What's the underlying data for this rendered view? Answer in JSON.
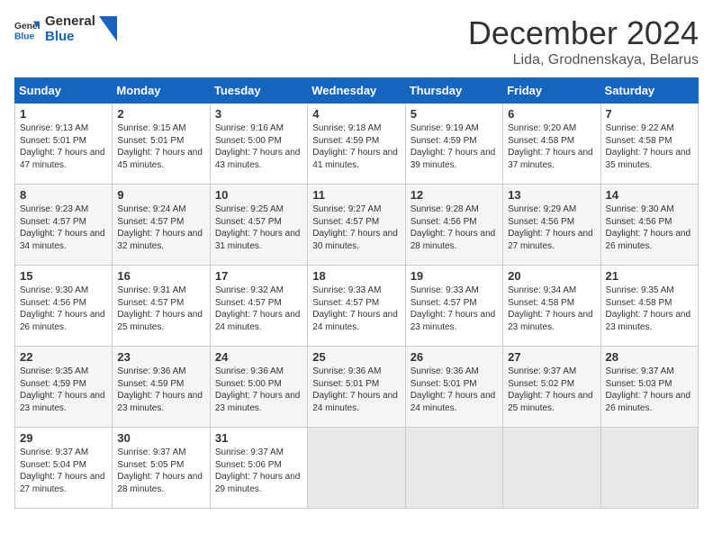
{
  "header": {
    "logo_general": "General",
    "logo_blue": "Blue",
    "month": "December 2024",
    "location": "Lida, Grodnenskaya, Belarus"
  },
  "weekdays": [
    "Sunday",
    "Monday",
    "Tuesday",
    "Wednesday",
    "Thursday",
    "Friday",
    "Saturday"
  ],
  "weeks": [
    [
      {
        "day": "1",
        "sunrise": "Sunrise: 9:13 AM",
        "sunset": "Sunset: 5:01 PM",
        "daylight": "Daylight: 7 hours and 47 minutes."
      },
      {
        "day": "2",
        "sunrise": "Sunrise: 9:15 AM",
        "sunset": "Sunset: 5:01 PM",
        "daylight": "Daylight: 7 hours and 45 minutes."
      },
      {
        "day": "3",
        "sunrise": "Sunrise: 9:16 AM",
        "sunset": "Sunset: 5:00 PM",
        "daylight": "Daylight: 7 hours and 43 minutes."
      },
      {
        "day": "4",
        "sunrise": "Sunrise: 9:18 AM",
        "sunset": "Sunset: 4:59 PM",
        "daylight": "Daylight: 7 hours and 41 minutes."
      },
      {
        "day": "5",
        "sunrise": "Sunrise: 9:19 AM",
        "sunset": "Sunset: 4:59 PM",
        "daylight": "Daylight: 7 hours and 39 minutes."
      },
      {
        "day": "6",
        "sunrise": "Sunrise: 9:20 AM",
        "sunset": "Sunset: 4:58 PM",
        "daylight": "Daylight: 7 hours and 37 minutes."
      },
      {
        "day": "7",
        "sunrise": "Sunrise: 9:22 AM",
        "sunset": "Sunset: 4:58 PM",
        "daylight": "Daylight: 7 hours and 35 minutes."
      }
    ],
    [
      {
        "day": "8",
        "sunrise": "Sunrise: 9:23 AM",
        "sunset": "Sunset: 4:57 PM",
        "daylight": "Daylight: 7 hours and 34 minutes."
      },
      {
        "day": "9",
        "sunrise": "Sunrise: 9:24 AM",
        "sunset": "Sunset: 4:57 PM",
        "daylight": "Daylight: 7 hours and 32 minutes."
      },
      {
        "day": "10",
        "sunrise": "Sunrise: 9:25 AM",
        "sunset": "Sunset: 4:57 PM",
        "daylight": "Daylight: 7 hours and 31 minutes."
      },
      {
        "day": "11",
        "sunrise": "Sunrise: 9:27 AM",
        "sunset": "Sunset: 4:57 PM",
        "daylight": "Daylight: 7 hours and 30 minutes."
      },
      {
        "day": "12",
        "sunrise": "Sunrise: 9:28 AM",
        "sunset": "Sunset: 4:56 PM",
        "daylight": "Daylight: 7 hours and 28 minutes."
      },
      {
        "day": "13",
        "sunrise": "Sunrise: 9:29 AM",
        "sunset": "Sunset: 4:56 PM",
        "daylight": "Daylight: 7 hours and 27 minutes."
      },
      {
        "day": "14",
        "sunrise": "Sunrise: 9:30 AM",
        "sunset": "Sunset: 4:56 PM",
        "daylight": "Daylight: 7 hours and 26 minutes."
      }
    ],
    [
      {
        "day": "15",
        "sunrise": "Sunrise: 9:30 AM",
        "sunset": "Sunset: 4:56 PM",
        "daylight": "Daylight: 7 hours and 26 minutes."
      },
      {
        "day": "16",
        "sunrise": "Sunrise: 9:31 AM",
        "sunset": "Sunset: 4:57 PM",
        "daylight": "Daylight: 7 hours and 25 minutes."
      },
      {
        "day": "17",
        "sunrise": "Sunrise: 9:32 AM",
        "sunset": "Sunset: 4:57 PM",
        "daylight": "Daylight: 7 hours and 24 minutes."
      },
      {
        "day": "18",
        "sunrise": "Sunrise: 9:33 AM",
        "sunset": "Sunset: 4:57 PM",
        "daylight": "Daylight: 7 hours and 24 minutes."
      },
      {
        "day": "19",
        "sunrise": "Sunrise: 9:33 AM",
        "sunset": "Sunset: 4:57 PM",
        "daylight": "Daylight: 7 hours and 23 minutes."
      },
      {
        "day": "20",
        "sunrise": "Sunrise: 9:34 AM",
        "sunset": "Sunset: 4:58 PM",
        "daylight": "Daylight: 7 hours and 23 minutes."
      },
      {
        "day": "21",
        "sunrise": "Sunrise: 9:35 AM",
        "sunset": "Sunset: 4:58 PM",
        "daylight": "Daylight: 7 hours and 23 minutes."
      }
    ],
    [
      {
        "day": "22",
        "sunrise": "Sunrise: 9:35 AM",
        "sunset": "Sunset: 4:59 PM",
        "daylight": "Daylight: 7 hours and 23 minutes."
      },
      {
        "day": "23",
        "sunrise": "Sunrise: 9:36 AM",
        "sunset": "Sunset: 4:59 PM",
        "daylight": "Daylight: 7 hours and 23 minutes."
      },
      {
        "day": "24",
        "sunrise": "Sunrise: 9:36 AM",
        "sunset": "Sunset: 5:00 PM",
        "daylight": "Daylight: 7 hours and 23 minutes."
      },
      {
        "day": "25",
        "sunrise": "Sunrise: 9:36 AM",
        "sunset": "Sunset: 5:01 PM",
        "daylight": "Daylight: 7 hours and 24 minutes."
      },
      {
        "day": "26",
        "sunrise": "Sunrise: 9:36 AM",
        "sunset": "Sunset: 5:01 PM",
        "daylight": "Daylight: 7 hours and 24 minutes."
      },
      {
        "day": "27",
        "sunrise": "Sunrise: 9:37 AM",
        "sunset": "Sunset: 5:02 PM",
        "daylight": "Daylight: 7 hours and 25 minutes."
      },
      {
        "day": "28",
        "sunrise": "Sunrise: 9:37 AM",
        "sunset": "Sunset: 5:03 PM",
        "daylight": "Daylight: 7 hours and 26 minutes."
      }
    ],
    [
      {
        "day": "29",
        "sunrise": "Sunrise: 9:37 AM",
        "sunset": "Sunset: 5:04 PM",
        "daylight": "Daylight: 7 hours and 27 minutes."
      },
      {
        "day": "30",
        "sunrise": "Sunrise: 9:37 AM",
        "sunset": "Sunset: 5:05 PM",
        "daylight": "Daylight: 7 hours and 28 minutes."
      },
      {
        "day": "31",
        "sunrise": "Sunrise: 9:37 AM",
        "sunset": "Sunset: 5:06 PM",
        "daylight": "Daylight: 7 hours and 29 minutes."
      },
      null,
      null,
      null,
      null
    ]
  ]
}
